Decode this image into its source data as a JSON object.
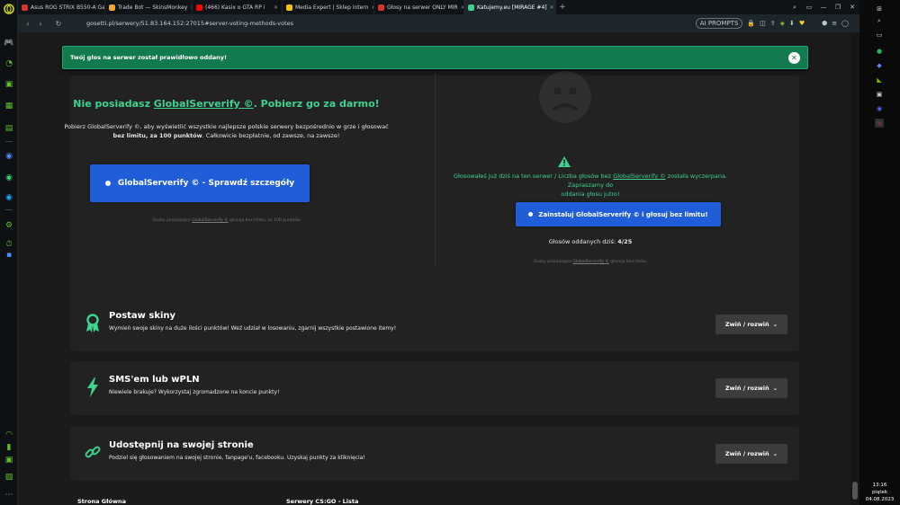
{
  "browser": {
    "tabs": [
      {
        "title": "Asus ROG STRIX B550-A Ga",
        "icon": "red-arrow-icon",
        "color": "#d9342b"
      },
      {
        "title": "Trade Bot — SkinsMonkey",
        "icon": "monkey-icon",
        "color": "#f2a531"
      },
      {
        "title": "(466) Kasix o GTA RP i",
        "icon": "youtube-icon",
        "color": "#ff0000"
      },
      {
        "title": "Media Expert | Sklep intern",
        "icon": "media-expert-icon",
        "color": "#f4c300"
      },
      {
        "title": "Głosy na serwer ONLY MIR",
        "icon": "red-arrow-icon",
        "color": "#d9342b"
      },
      {
        "title": "Katujemy.eu [MIRAGE #4]",
        "icon": "gamepad-icon",
        "color": "#3fd28f"
      }
    ],
    "new_tab": "+",
    "url": "gosetti.pl/serwery/51.83.164.152:27015#server-voting-methods-votes",
    "ai_prompts": "AI PROMPTS"
  },
  "notification": {
    "text": "Twój głos na serwer został prawidłowo oddany!",
    "close": "✕"
  },
  "left_panel": {
    "title_pre": "Nie posiadasz ",
    "title_link": "GlobalServerify ©",
    "title_post": ". Pobierz go za darmo!",
    "desc_line1": "Pobierz GlobalServerify ©, aby wyświetlić wszystkie najlepsze polskie serwery bezpośrednio w grze i głosować",
    "desc_bold": "bez limitu, za 100 punktów",
    "desc_line2_rest": ". Całkowicie bezpłatnie, od zawsze, na zawsze!",
    "button": "GlobalServerify © - Sprawdź szczegóły",
    "note_pre": "Osoby posiadające ",
    "note_link": "GlobalServerify ©",
    "note_post": " głosują bez limitu, za 100 punktów"
  },
  "right_panel": {
    "desc_pre": "Głosowałeś już dziś na ten serwer / Liczba głosów bez ",
    "desc_link": "GlobalServerify ©",
    "desc_post": " została wyczerpana. Zapraszamy do",
    "desc_line2": "oddania głosu jutro!",
    "button": "Zainstaluj GlobalServerify © i głosuj bez limitu!",
    "votes_label": "Głosów oddanych dziś: ",
    "votes_value": "4/25",
    "note_pre": "Osoby posiadające ",
    "note_link": "GlobalServerify ©",
    "note_post": " głosują bez limitu."
  },
  "sections": [
    {
      "title": "Postaw skiny",
      "desc": "Wymień swoje skiny na duże ilości punktów! Weź udział w losowaniu, zgarnij wszystkie postawione itemy!",
      "button": "Zwiń / rozwiń",
      "icon": "award-icon"
    },
    {
      "title": "SMS'em lub wPLN",
      "desc": "Niewiele brakuje? Wykorzystaj zgromadzone na koncie punkty!",
      "button": "Zwiń / rozwiń",
      "icon": "lightning-icon"
    },
    {
      "title": "Udostępnij na swojej stronie",
      "desc": "Podziel się głosowaniem na swojej stronie, fanpage'u, facebooku. Uzyskaj punkty za kliknięcia!",
      "button": "Zwiń / rozwiń",
      "icon": "link-icon"
    }
  ],
  "footer": {
    "link1": "Strona Główna",
    "link2": "Serwery CS:GO - Lista"
  },
  "taskbar": {
    "time": "13:16",
    "day": "piątek",
    "date": "04.08.2023"
  },
  "colors": {
    "accent_green": "#3fd28f",
    "button_blue": "#1f5ed8",
    "notification_green": "#137a4f"
  }
}
